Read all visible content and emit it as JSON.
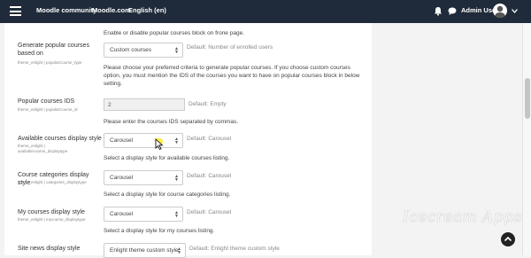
{
  "topbar": {
    "site_name": "Moodle community",
    "site_link": "Moodle.com",
    "language": "English (en)",
    "user_name": "Admin User",
    "bell_icon": "bell-icon",
    "chat_icon": "chat-icon",
    "menu_icon": "hamburger-menu-icon",
    "caret_icon": "chevron-down-icon",
    "bg": "#1f2b3a"
  },
  "settings": {
    "top_desc": "Enable or disable popular courses block on frone page.",
    "popular_courses": {
      "label": "Generate popular courses based on",
      "sub": "theme_enlight | popularCourse_type",
      "value": "Custom courses",
      "default": "Default: Number of enrolled users",
      "desc": "Please choose your preferred criteria to generate popular courses. If you choose custom courses option, you must mention the IDS of the courses you want to have on popular courses block in below setting."
    },
    "popular_ids": {
      "label": "Popular courses IDS",
      "sub": "theme_enlight | popularCourse_id",
      "value": "2",
      "default": "Default: Empty",
      "desc": "Please enter the courses IDS separated by commas."
    },
    "available_style": {
      "label": "Available courses display style",
      "sub1": "theme_enlight |",
      "sub2": "availablecourse_displaytype",
      "value": "Carousel",
      "default": "Default: Carousel",
      "desc": "Select a display style for available courses listing."
    },
    "categories_style": {
      "label": "Course categories display style",
      "sub": "theme_enlight | categories_displaytype",
      "value": "Carousel",
      "default": "Default: Carousel",
      "desc": "Select a display style for course categories listing."
    },
    "my_courses_style": {
      "label": "My courses display style",
      "sub": "theme_enlight | mycourse_displaytype",
      "value": "Carousel",
      "default": "Default: Carousel",
      "desc": "Select a display style for my courses listing."
    },
    "site_news_style": {
      "label": "Site news display style",
      "value": "Enlight theme custom style",
      "default": "Default: Enlight theme custom style"
    }
  },
  "watermark": "Icecream Apps",
  "scroll_top_icon": "chevron-up-icon"
}
